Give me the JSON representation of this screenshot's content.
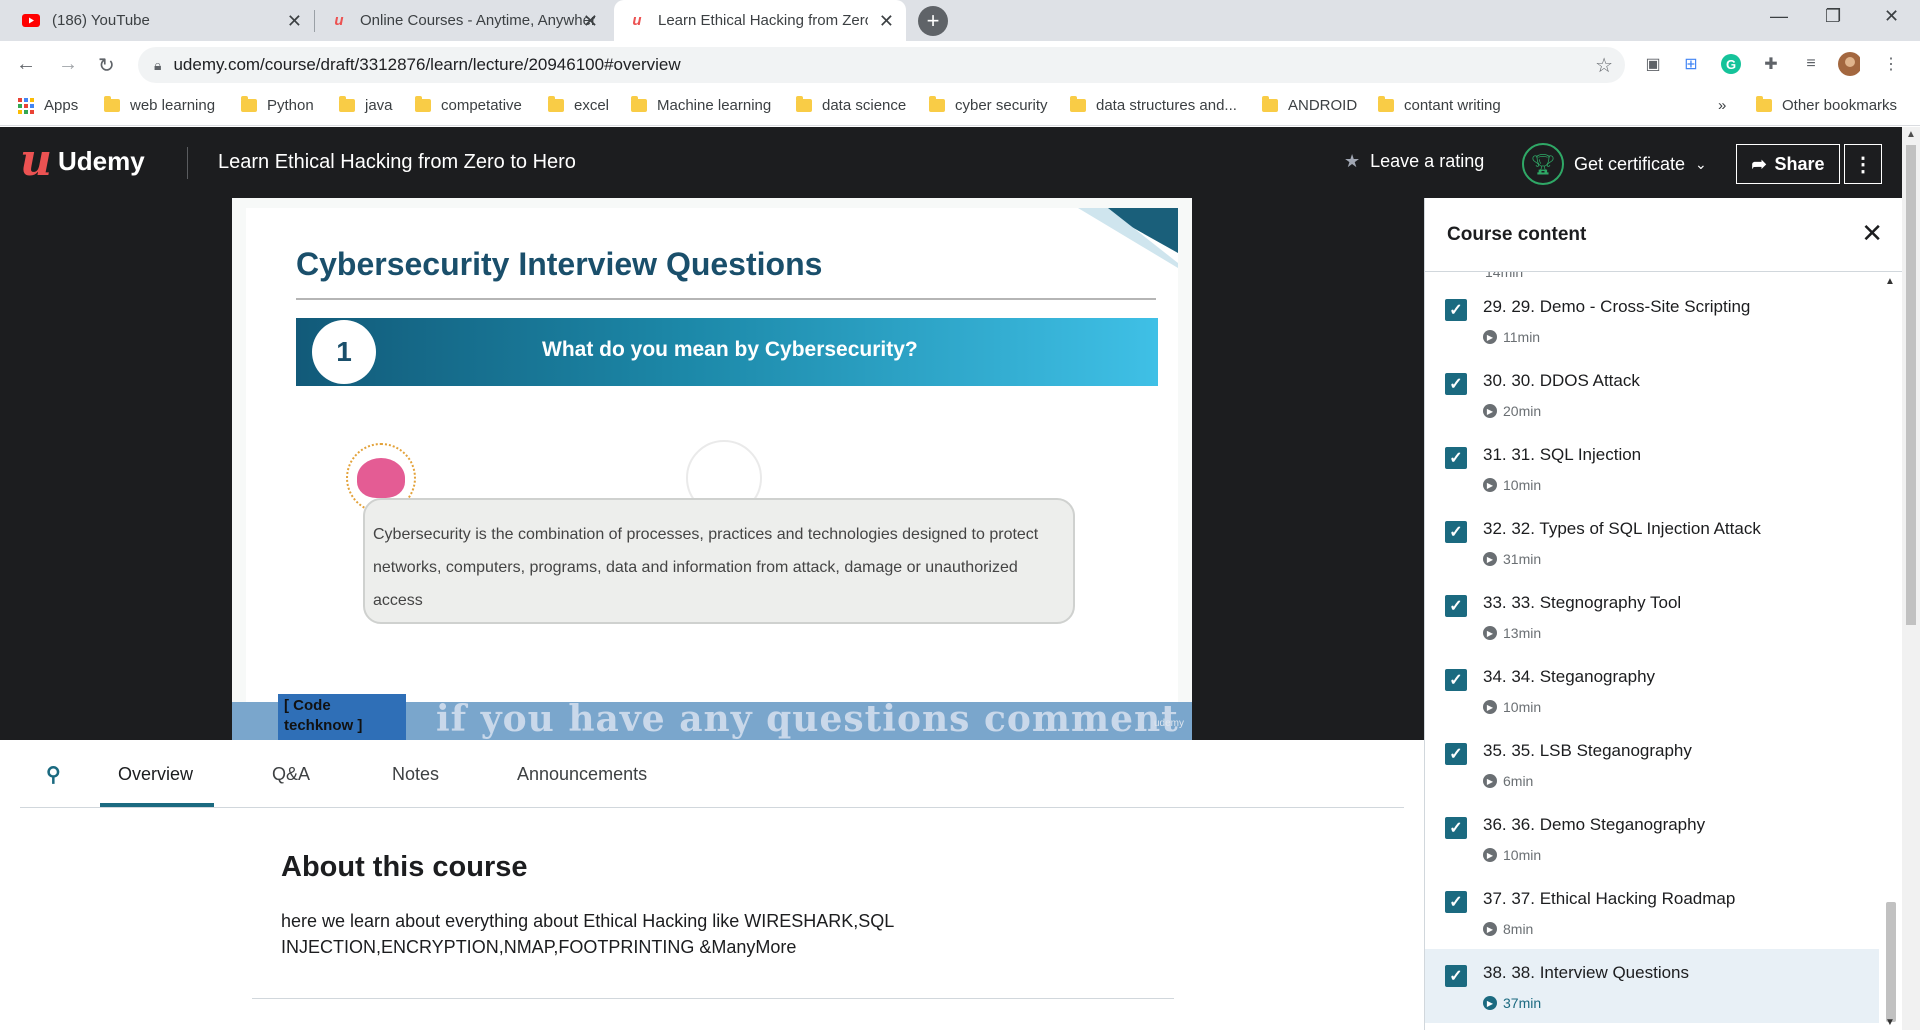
{
  "browser": {
    "tabs": [
      {
        "title": "(186) YouTube"
      },
      {
        "title": "Online Courses - Anytime, Anywhere"
      },
      {
        "title": "Learn Ethical Hacking from Zero to Hero"
      }
    ],
    "url": "udemy.com/course/draft/3312876/learn/lecture/20946100#overview",
    "bookmarks": [
      "Apps",
      "web learning",
      "Python",
      "java",
      "competative",
      "excel",
      "Machine learning",
      "data science",
      "cyber security",
      "data structures and...",
      "ANDROID",
      "contant writing"
    ],
    "more_bookmarks": "»",
    "other_bookmarks": "Other bookmarks"
  },
  "header": {
    "logo": "Udemy",
    "course_title": "Learn Ethical Hacking from Zero to Hero",
    "rating_label": "Leave a rating",
    "certificate_label": "Get certificate",
    "share_label": "Share"
  },
  "slide": {
    "title": "Cybersecurity Interview Questions",
    "question_number": "1",
    "question": "What do you mean by Cybersecurity?",
    "answer": "Cybersecurity is the combination of processes, practices and technologies designed to protect networks, computers, programs, data and information from attack, damage or unauthorized access",
    "badge": "[ Code techknow ]",
    "caption": "if you have any questions comment me",
    "watermark": "udemy"
  },
  "content_tabs": [
    "Overview",
    "Q&A",
    "Notes",
    "Announcements"
  ],
  "about": {
    "title": "About this course",
    "text": "here we learn about everything about Ethical Hacking like WIRESHARK,SQL INJECTION,ENCRYPTION,NMAP,FOOTPRINTING &ManyMore"
  },
  "sidebar": {
    "title": "Course content",
    "partial_duration": "14min",
    "lectures": [
      {
        "title": "29. 29. Demo - Cross-Site Scripting",
        "duration": "11min"
      },
      {
        "title": "30. 30. DDOS Attack",
        "duration": "20min"
      },
      {
        "title": "31. 31. SQL Injection",
        "duration": "10min"
      },
      {
        "title": "32. 32. Types of SQL Injection Attack",
        "duration": "31min"
      },
      {
        "title": "33. 33. Stegnography Tool",
        "duration": "13min"
      },
      {
        "title": "34. 34. Steganography",
        "duration": "10min"
      },
      {
        "title": "35. 35. LSB Steganography",
        "duration": "6min"
      },
      {
        "title": "36. 36. Demo Steganography",
        "duration": "10min"
      },
      {
        "title": "37. 37. Ethical Hacking Roadmap",
        "duration": "8min"
      },
      {
        "title": "38. 38. Interview Questions",
        "duration": "37min"
      }
    ]
  },
  "colors": {
    "udemy_red": "#ec5252",
    "header_bg": "#1c1d1f",
    "accent_teal": "#1b6a80",
    "certificate_green": "#2fa866"
  }
}
